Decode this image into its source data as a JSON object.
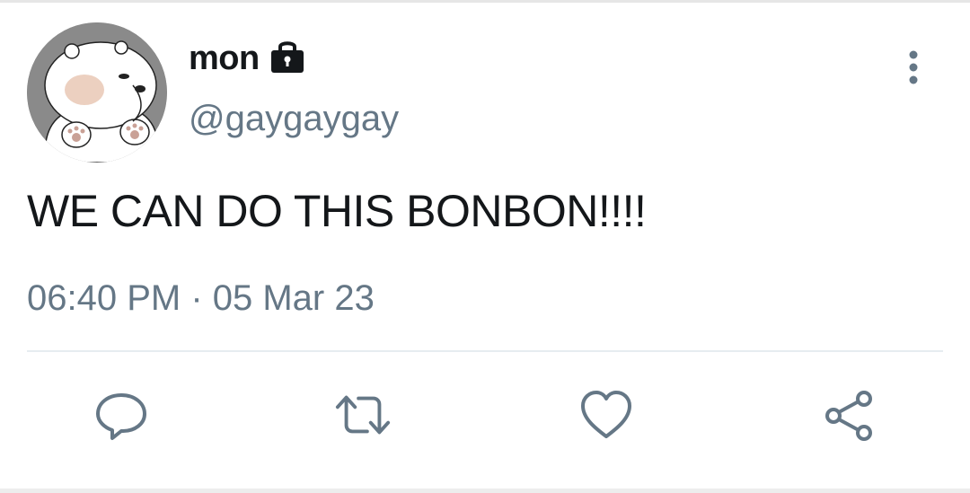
{
  "tweet": {
    "display_name": "mon",
    "handle": "@gaygaygay",
    "text": "WE CAN DO THIS BONBON!!!!",
    "timestamp": "06:40 PM · 05 Mar 23",
    "account_protected": true
  },
  "icons": {
    "lock": "lock-icon",
    "more": "more-vertical-icon",
    "reply": "reply-icon",
    "retweet": "retweet-icon",
    "like": "heart-icon",
    "share": "share-icon"
  },
  "colors": {
    "text_primary": "#14171a",
    "text_secondary": "#657786",
    "icon": "#657786",
    "divider": "#e6ecf0",
    "avatar_background": "#8a8a8a"
  }
}
